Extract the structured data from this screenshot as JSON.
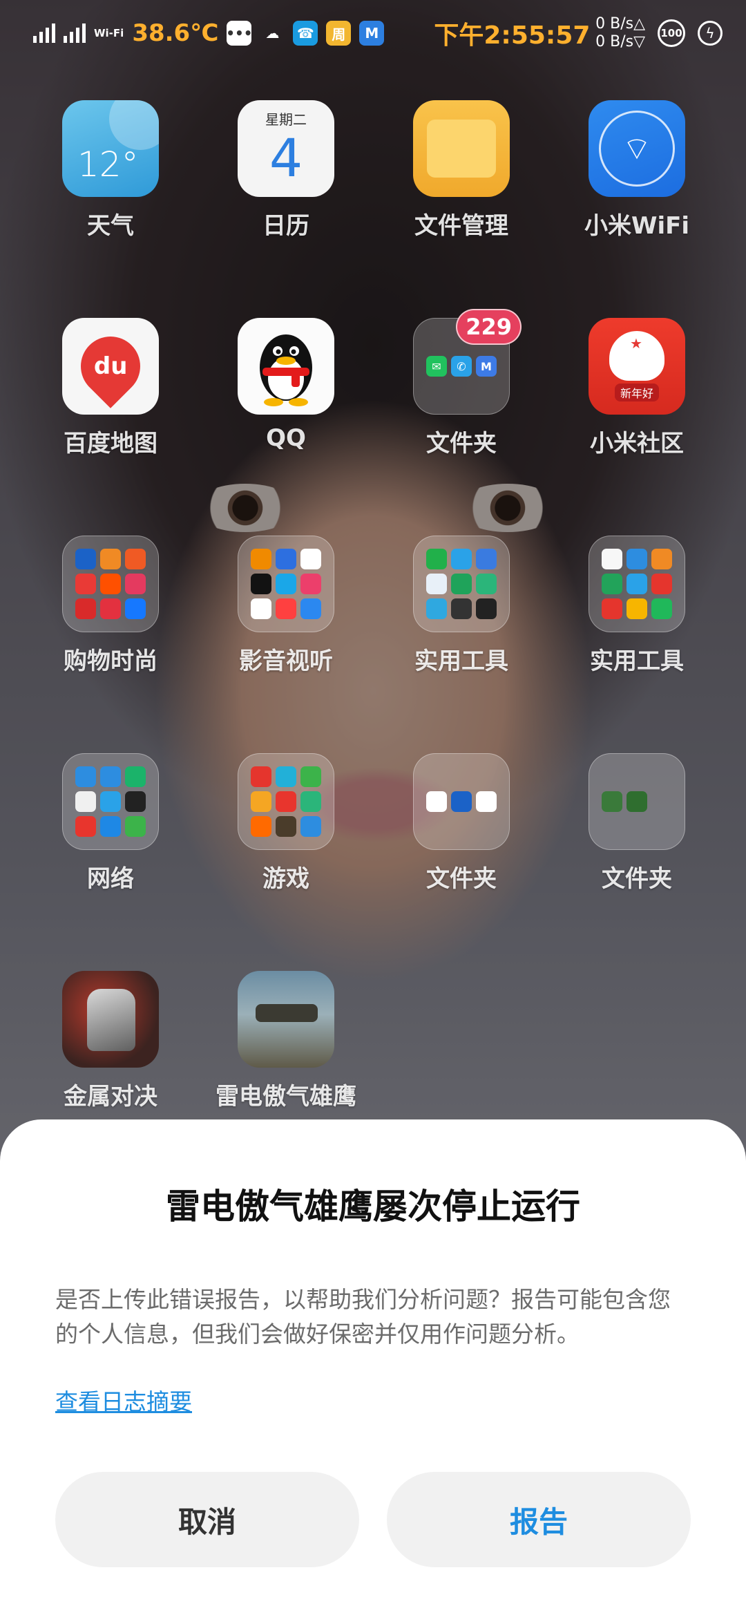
{
  "status_bar": {
    "wifi_label": "Wi-Fi",
    "temperature": "38.6℃",
    "time": "下午2:55:57",
    "net_speed_up": "0 B/s△",
    "net_speed_down": "0 B/s▽",
    "battery_level": "100"
  },
  "home": {
    "row1": [
      {
        "label": "天气",
        "icon": "weather-icon",
        "temp": "12°"
      },
      {
        "label": "日历",
        "icon": "calendar-icon",
        "weekday": "星期二",
        "day": "4"
      },
      {
        "label": "文件管理",
        "icon": "file-manager-icon"
      },
      {
        "label": "小米WiFi",
        "icon": "mi-wifi-icon"
      }
    ],
    "row2": [
      {
        "label": "百度地图",
        "icon": "baidu-maps-icon",
        "logo": "du"
      },
      {
        "label": "QQ",
        "icon": "qq-icon"
      },
      {
        "label": "文件夹",
        "icon": "folder-icon",
        "badge": "229"
      },
      {
        "label": "小米社区",
        "icon": "mi-community-icon",
        "tag": "新年好"
      }
    ],
    "row3": [
      {
        "label": "购物时尚",
        "icon": "folder-icon"
      },
      {
        "label": "影音视听",
        "icon": "folder-icon"
      },
      {
        "label": "实用工具",
        "icon": "folder-icon"
      },
      {
        "label": "实用工具",
        "icon": "folder-icon"
      }
    ],
    "row4": [
      {
        "label": "网络",
        "icon": "folder-icon"
      },
      {
        "label": "游戏",
        "icon": "folder-icon"
      },
      {
        "label": "文件夹",
        "icon": "folder-icon"
      },
      {
        "label": "文件夹",
        "icon": "folder-icon"
      }
    ],
    "row5": [
      {
        "label": "金属对决",
        "icon": "metal-duel-game-icon"
      },
      {
        "label": "雷电傲气雄鹰",
        "icon": "thunder-eagle-game-icon"
      }
    ]
  },
  "dialog": {
    "title": "雷电傲气雄鹰屡次停止运行",
    "message": "是否上传此错误报告，以帮助我们分析问题？报告可能包含您的个人信息，但我们会做好保密并仅用作问题分析。",
    "link": "查看日志摘要",
    "cancel": "取消",
    "report": "报告"
  },
  "colors": {
    "accent_blue": "#1e8de0",
    "status_orange": "#ffb02e",
    "badge_red": "#e5405e"
  }
}
